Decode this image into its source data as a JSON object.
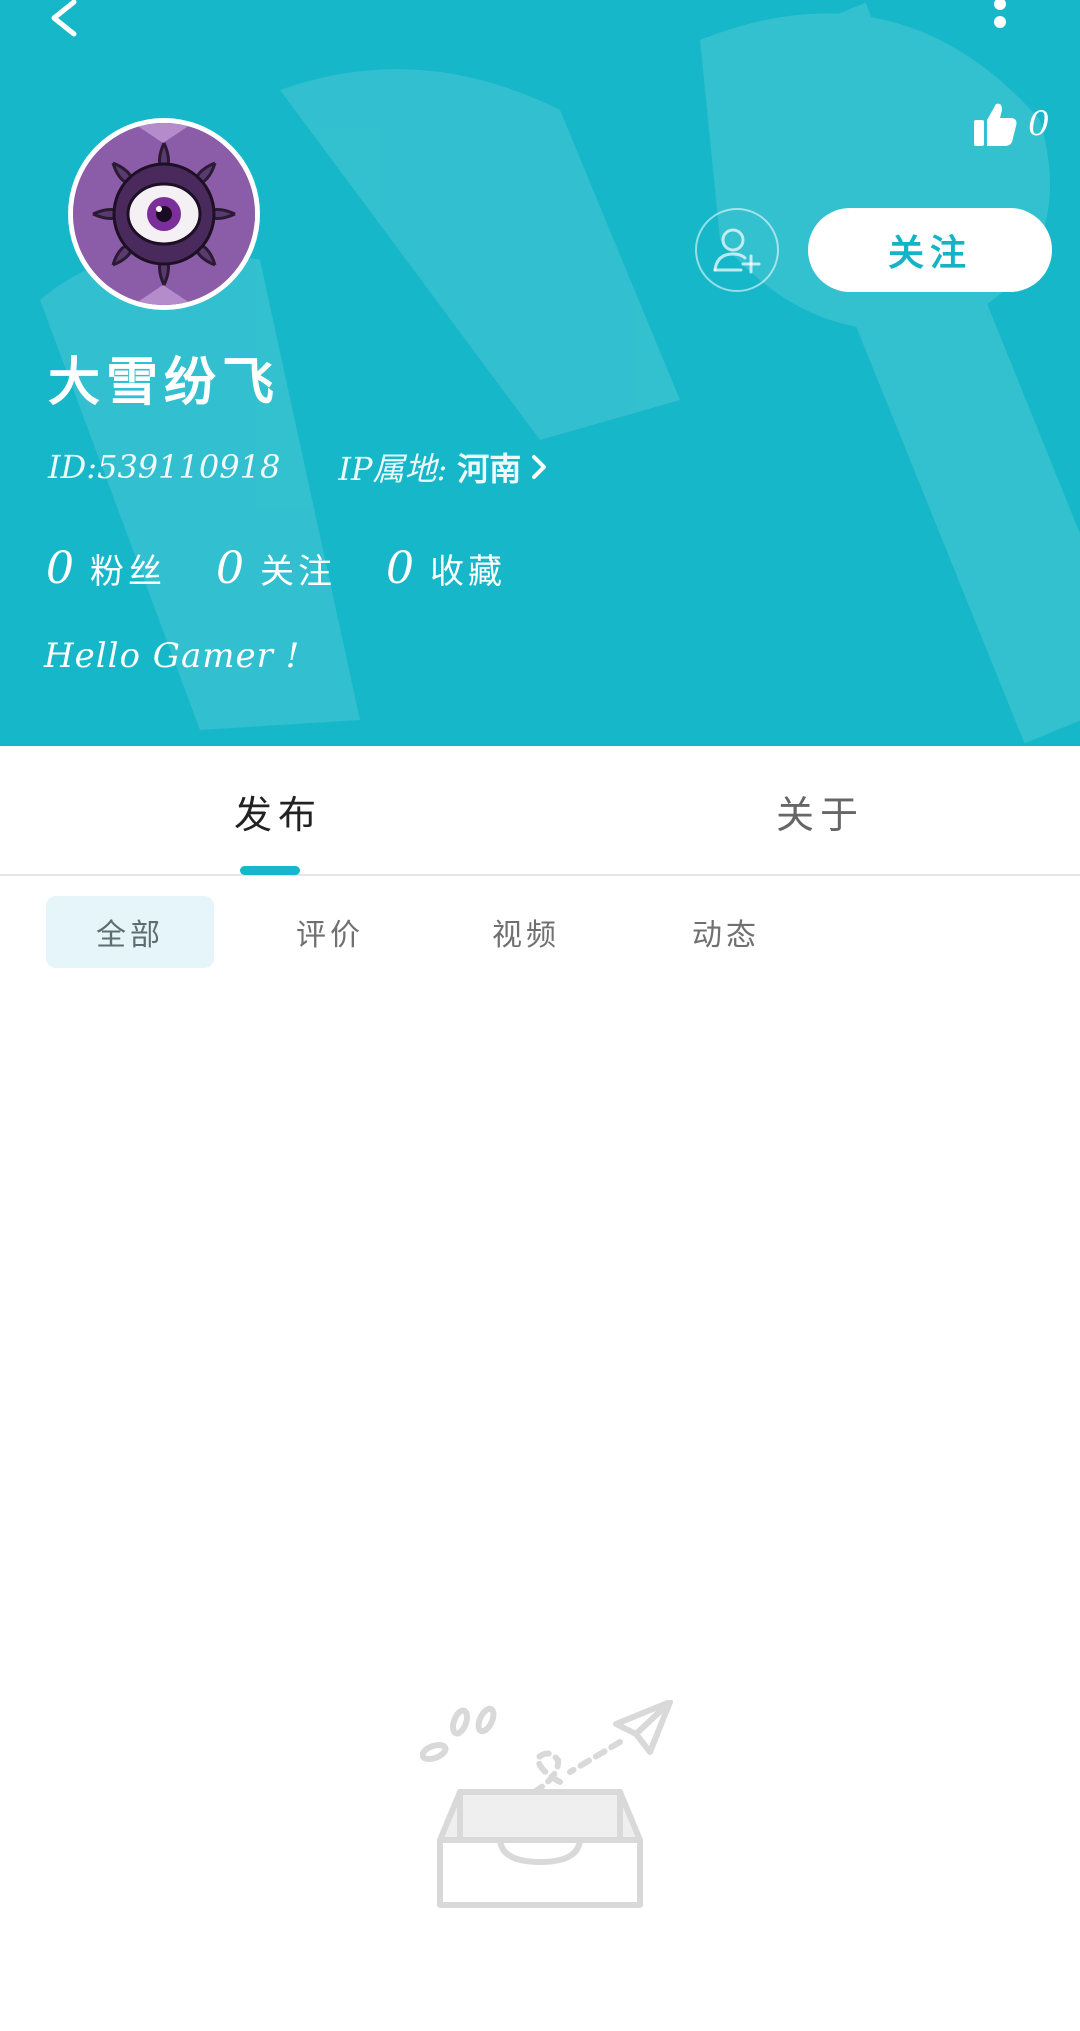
{
  "profile": {
    "likes_count": "0",
    "follow_label": "关注",
    "username": "大雪纷飞",
    "id_text": "ID:539110918",
    "ip_label": "IP属地:",
    "ip_value": "河南",
    "stats": [
      {
        "count": "0",
        "label": "粉丝"
      },
      {
        "count": "0",
        "label": "关注"
      },
      {
        "count": "0",
        "label": "收藏"
      }
    ],
    "bio": "Hello Gamer !"
  },
  "tabs": [
    {
      "label": "发布",
      "active": true
    },
    {
      "label": "关于",
      "active": false
    }
  ],
  "filters": [
    {
      "label": "全部",
      "active": true
    },
    {
      "label": "评价",
      "active": false
    },
    {
      "label": "视频",
      "active": false
    },
    {
      "label": "动态",
      "active": false
    }
  ],
  "colors": {
    "brand": "#16b7c9",
    "filter_active_bg": "#e6f5f9"
  },
  "icons": {
    "back": "chevron-left-icon",
    "more": "more-vertical-icon",
    "like": "thumbs-up-icon",
    "add_friend": "add-user-icon",
    "ip_more": "chevron-right-icon",
    "empty": "empty-inbox-illustration"
  }
}
